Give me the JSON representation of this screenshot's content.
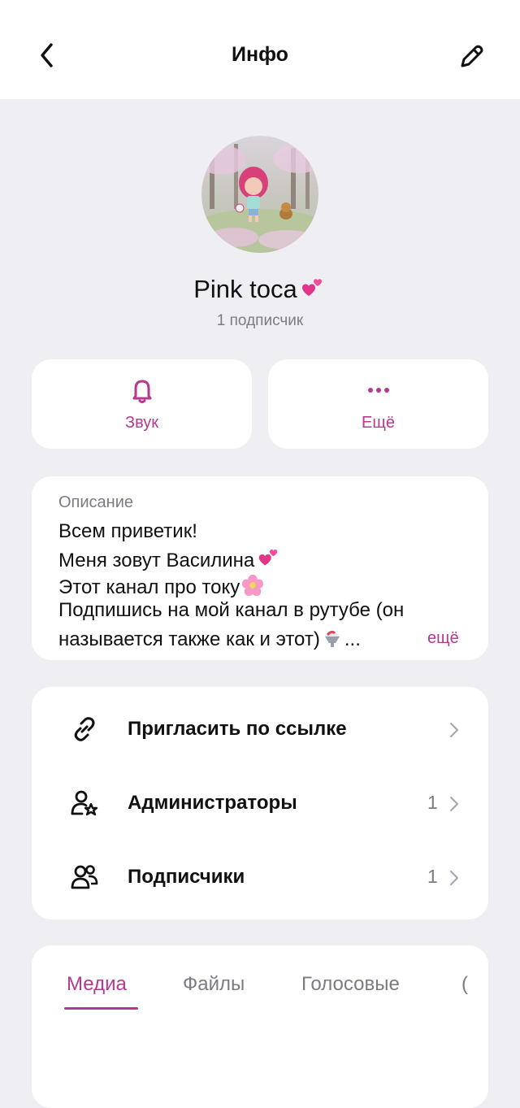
{
  "header": {
    "title": "Инфо"
  },
  "channel": {
    "name": "Pink toca",
    "subscribers": "1 подписчик"
  },
  "actions": [
    {
      "label": "Звук",
      "icon": "bell-icon"
    },
    {
      "label": "Ещё",
      "icon": "more-dots-icon"
    }
  ],
  "description": {
    "heading": "Описание",
    "lines": [
      "Всем приветик!",
      "Меня зовут Василина",
      "Этот канал про току",
      "Подпишись на мой канал в рутубе (он",
      "называется также как и этот)"
    ],
    "ellipsis": "...",
    "more": "ещё"
  },
  "menu": [
    {
      "label": "Пригласить по ссылке",
      "count": "",
      "icon": "link-icon"
    },
    {
      "label": "Администраторы",
      "count": "1",
      "icon": "admin-star-icon"
    },
    {
      "label": "Подписчики",
      "count": "1",
      "icon": "people-icon"
    }
  ],
  "tabs": [
    "Медиа",
    "Файлы",
    "Голосовые"
  ],
  "colors": {
    "accent": "#b5398e",
    "background": "#efeef3",
    "card": "#ffffff",
    "muted": "#7c7b82"
  }
}
